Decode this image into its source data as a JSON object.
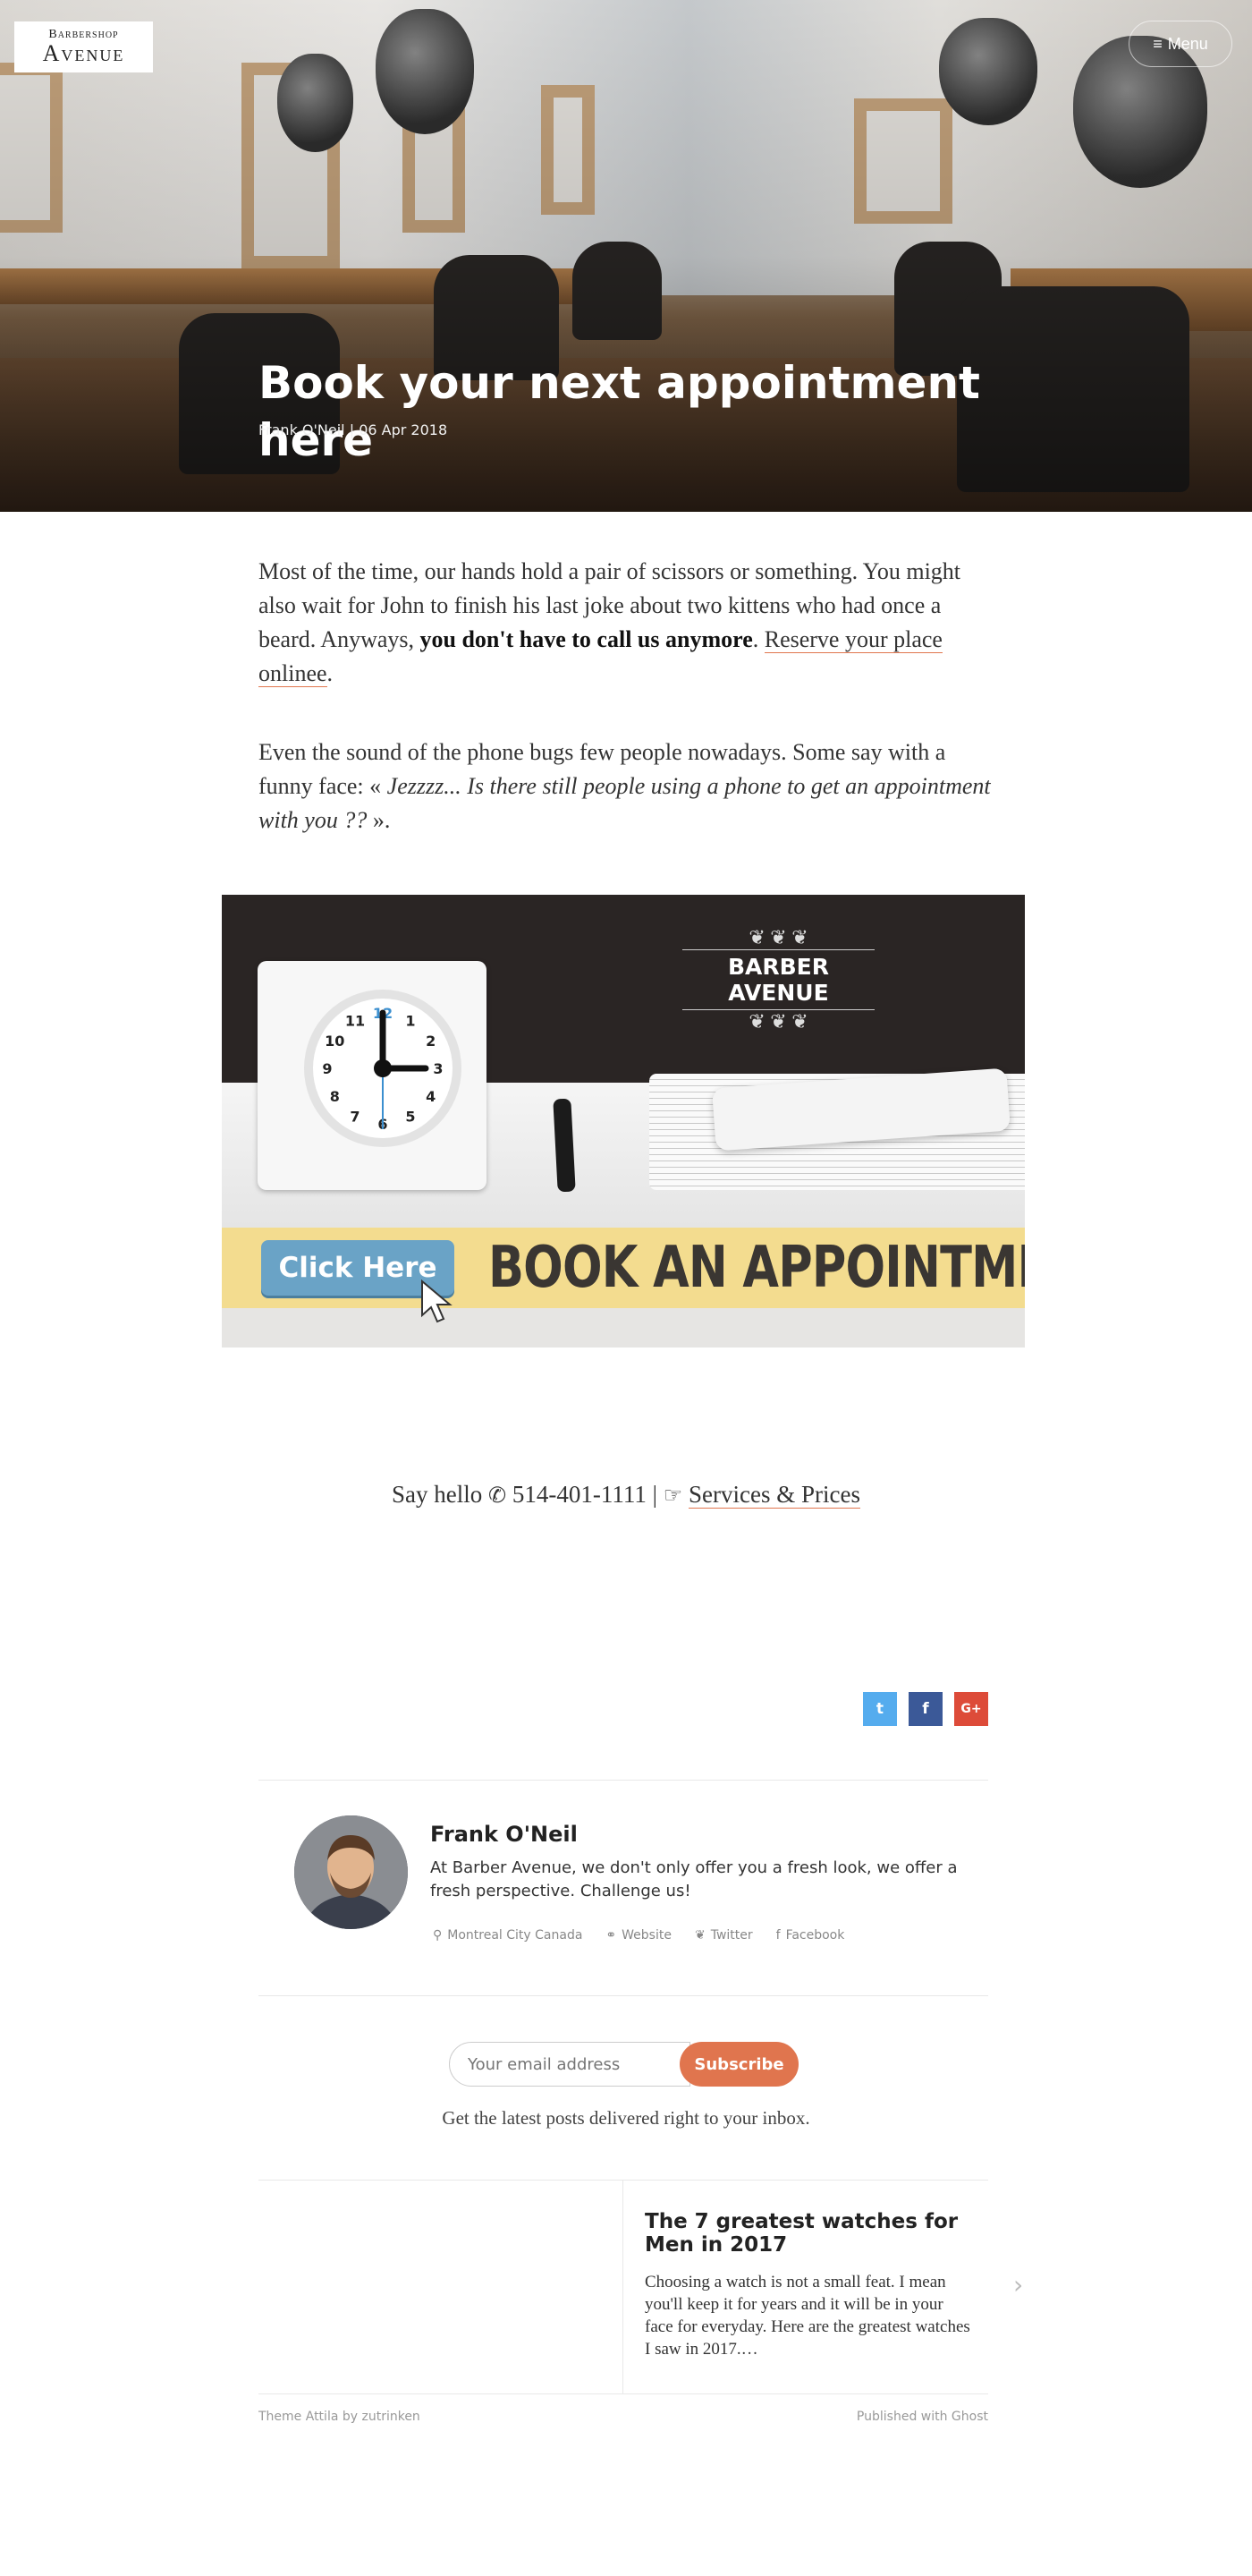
{
  "header": {
    "logo_line1": "Barbershop",
    "logo_line2": "Avenue",
    "menu_label": "Menu",
    "menu_icon": "hamburger-icon"
  },
  "hero": {
    "title": "Book your next appointment here",
    "author": "Frank O'Neil",
    "separator": "|",
    "date": "06 Apr 2018"
  },
  "article": {
    "p1_a": "Most of the time, our hands hold a pair of scissors or something. You might also wait for John to finish his last joke about two kittens who had once a beard. Anyways, ",
    "p1_bold": "you don't have to call us anymore",
    "p1_dot": ". ",
    "p1_link": "Reserve your place onlinee",
    "p1_end": ".",
    "p2_a": "Even the sound of the phone bugs few people nowadays. Some say with a funny face: « ",
    "p2_italic": "Jezzzz... Is there still people using a phone to get an appointment with you ??",
    "p2_end": " »."
  },
  "banner": {
    "brand": "BARBER AVENUE",
    "button": "Click Here",
    "headline": "BOOK AN APPOINTMENT",
    "clock_numbers": [
      "12",
      "1",
      "2",
      "3",
      "4",
      "5",
      "6",
      "7",
      "8",
      "9",
      "10",
      "11"
    ]
  },
  "contact": {
    "say_hello": "Say hello",
    "phone_icon": "phone-icon",
    "phone": "514-401-1111",
    "separator": "|",
    "hand_icon": "pointing-hand-icon",
    "services_link": "Services & Prices"
  },
  "share": {
    "twitter_label": "t",
    "facebook_label": "f",
    "google_label": "G+",
    "colors": {
      "twitter": "#55acee",
      "facebook": "#3b5998",
      "google": "#dd4b39"
    }
  },
  "author": {
    "name": "Frank O'Neil",
    "bio": "At Barber Avenue, we don't only offer you a fresh look, we offer a fresh perspective. Challenge us!",
    "location": "Montreal City Canada",
    "website": "Website",
    "twitter": "Twitter",
    "facebook": "Facebook"
  },
  "subscribe": {
    "placeholder": "Your email address",
    "button": "Subscribe",
    "note": "Get the latest posts delivered right to your inbox."
  },
  "next_post": {
    "title": "The 7 greatest watches for Men in 2017",
    "excerpt": "Choosing a watch is not a small feat. I mean you'll keep it for years and it will be in your face for everyday. Here are the greatest watches I saw in 2017.…"
  },
  "footer": {
    "theme": "Theme Attila by zutrinken",
    "published": "Published with Ghost"
  },
  "colors": {
    "accent": "#e0754e",
    "strip": "#f3dc8f",
    "button_blue": "#6aa3c6"
  }
}
